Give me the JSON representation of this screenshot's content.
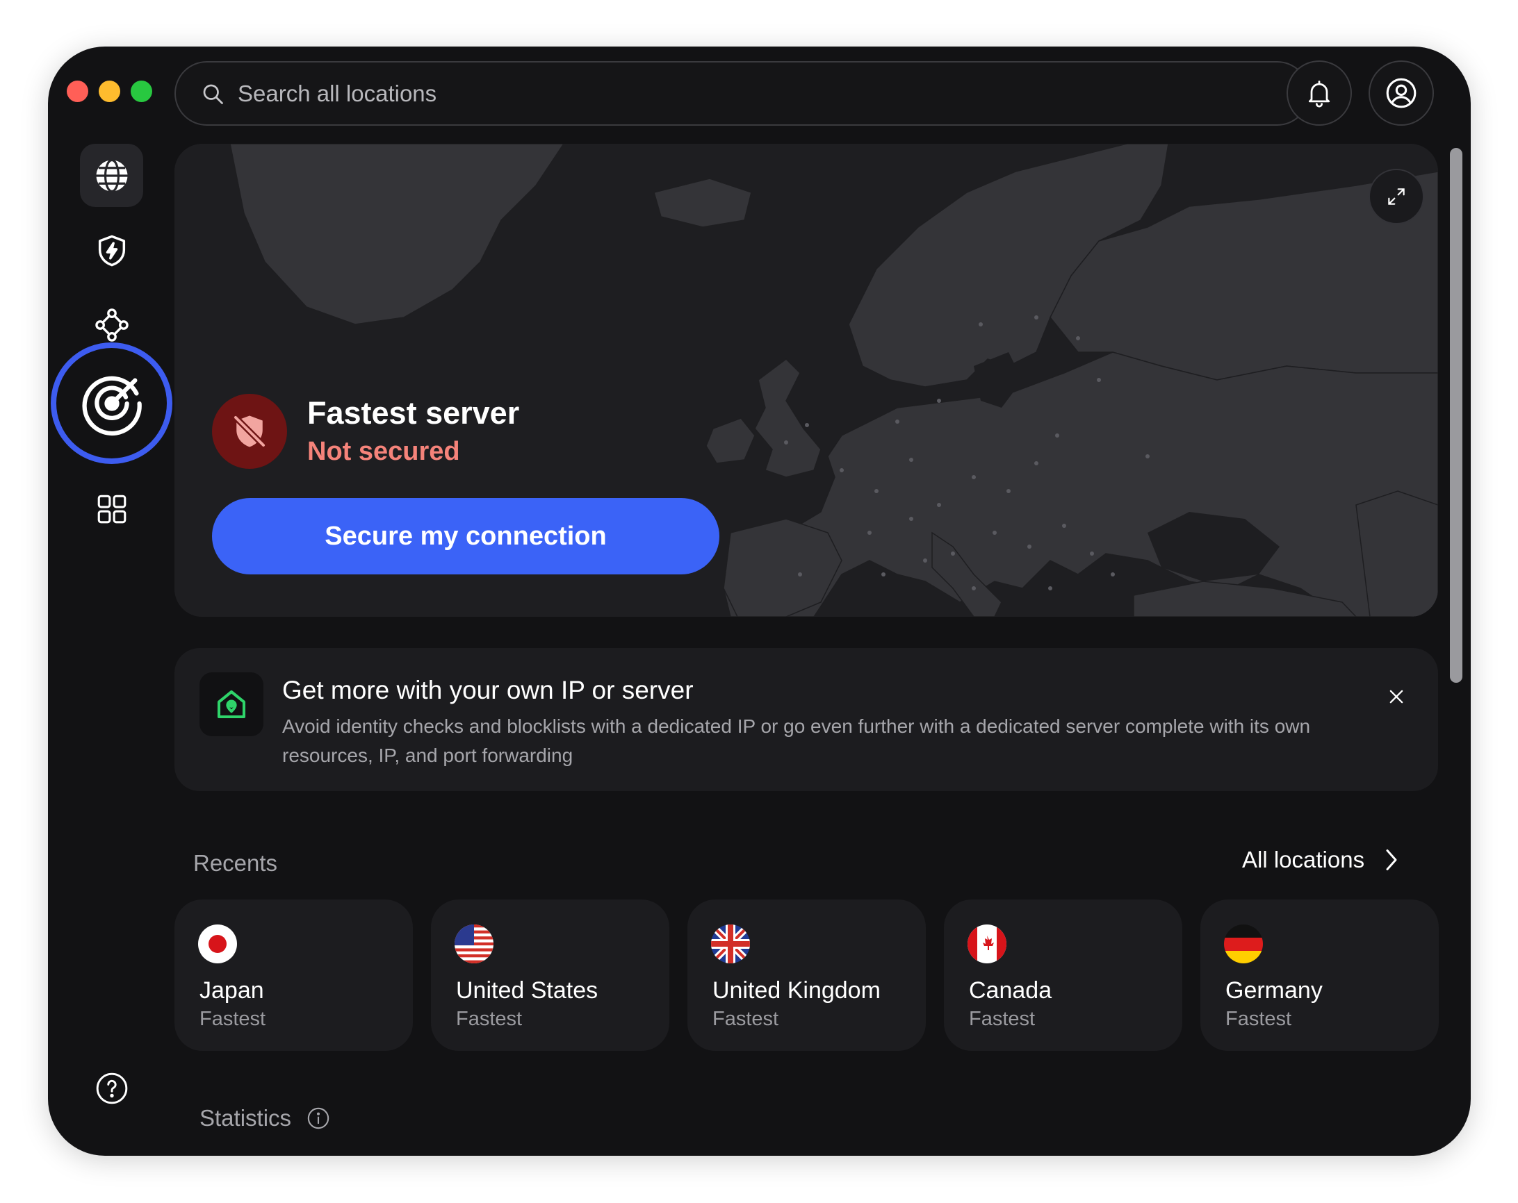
{
  "window": {
    "controls": [
      "close",
      "minimize",
      "zoom"
    ]
  },
  "search": {
    "placeholder": "Search all locations",
    "icon": "search-icon"
  },
  "header": {
    "notifications_icon": "bell-icon",
    "account_icon": "account-icon"
  },
  "sidebar": {
    "items": [
      {
        "name": "globe",
        "icon": "globe-icon",
        "active": true
      },
      {
        "name": "threat-protection",
        "icon": "shield-bolt-icon"
      },
      {
        "name": "meshnet",
        "icon": "meshnet-icon"
      },
      {
        "name": "dark-web-monitor",
        "icon": "radar-icon",
        "highlighted": true
      },
      {
        "name": "more-apps",
        "icon": "grid-icon"
      }
    ],
    "help_icon": "help-icon"
  },
  "connection": {
    "title": "Fastest server",
    "status": "Not secured",
    "button_label": "Secure my connection",
    "status_icon": "shield-off-icon"
  },
  "promo": {
    "title": "Get more with your own IP or server",
    "description": "Avoid identity checks and blocklists with a dedicated IP or go even further with a dedicated server complete with its own resources, IP, and port forwarding",
    "icon": "home-pin-icon"
  },
  "recents": {
    "label": "Recents",
    "all_locations_label": "All locations",
    "items": [
      {
        "country": "Japan",
        "sub": "Fastest",
        "flag": "flag-japan"
      },
      {
        "country": "United States",
        "sub": "Fastest",
        "flag": "flag-united-states"
      },
      {
        "country": "United Kingdom",
        "sub": "Fastest",
        "flag": "flag-united-kingdom"
      },
      {
        "country": "Canada",
        "sub": "Fastest",
        "flag": "flag-canada"
      },
      {
        "country": "Germany",
        "sub": "Fastest",
        "flag": "flag-germany"
      }
    ]
  },
  "statistics": {
    "label": "Statistics"
  },
  "colors": {
    "accent": "#3b63f7",
    "danger_text": "#f5837a",
    "danger_bg": "#6e1414",
    "highlight_ring": "#3d5cf0",
    "background": "#121214"
  }
}
